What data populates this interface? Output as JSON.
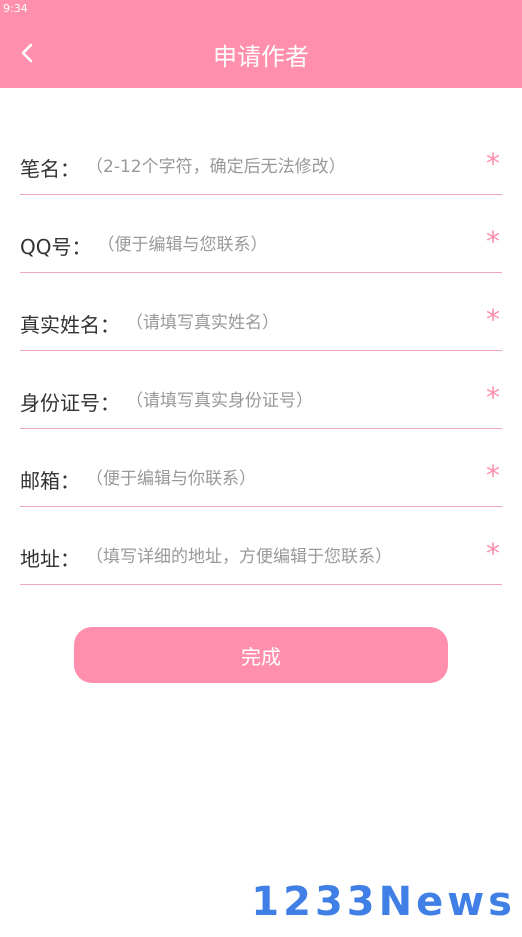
{
  "status_bar": {
    "time": "9:34"
  },
  "header": {
    "title": "申请作者",
    "back_icon": "chevron-left-icon"
  },
  "form": {
    "fields": [
      {
        "label": "笔名：",
        "placeholder": "（2-12个字符，确定后无法修改）",
        "value": "",
        "required": "*"
      },
      {
        "label": "QQ号：",
        "placeholder": "（便于编辑与您联系）",
        "value": "",
        "required": "*"
      },
      {
        "label": "真实姓名：",
        "placeholder": "（请填写真实姓名）",
        "value": "",
        "required": "*"
      },
      {
        "label": "身份证号：",
        "placeholder": "（请填写真实身份证号）",
        "value": "",
        "required": "*"
      },
      {
        "label": "邮箱：",
        "placeholder": "（便于编辑与你联系）",
        "value": "",
        "required": "*"
      },
      {
        "label": "地址：",
        "placeholder": "（填写详细的地址，方便编辑于您联系）",
        "value": "",
        "required": "*"
      }
    ],
    "submit_label": "完成"
  },
  "watermark": "1233News",
  "colors": {
    "accent": "#ff8fac",
    "divider": "#f2a6bd",
    "watermark": "#3f7fe6"
  }
}
